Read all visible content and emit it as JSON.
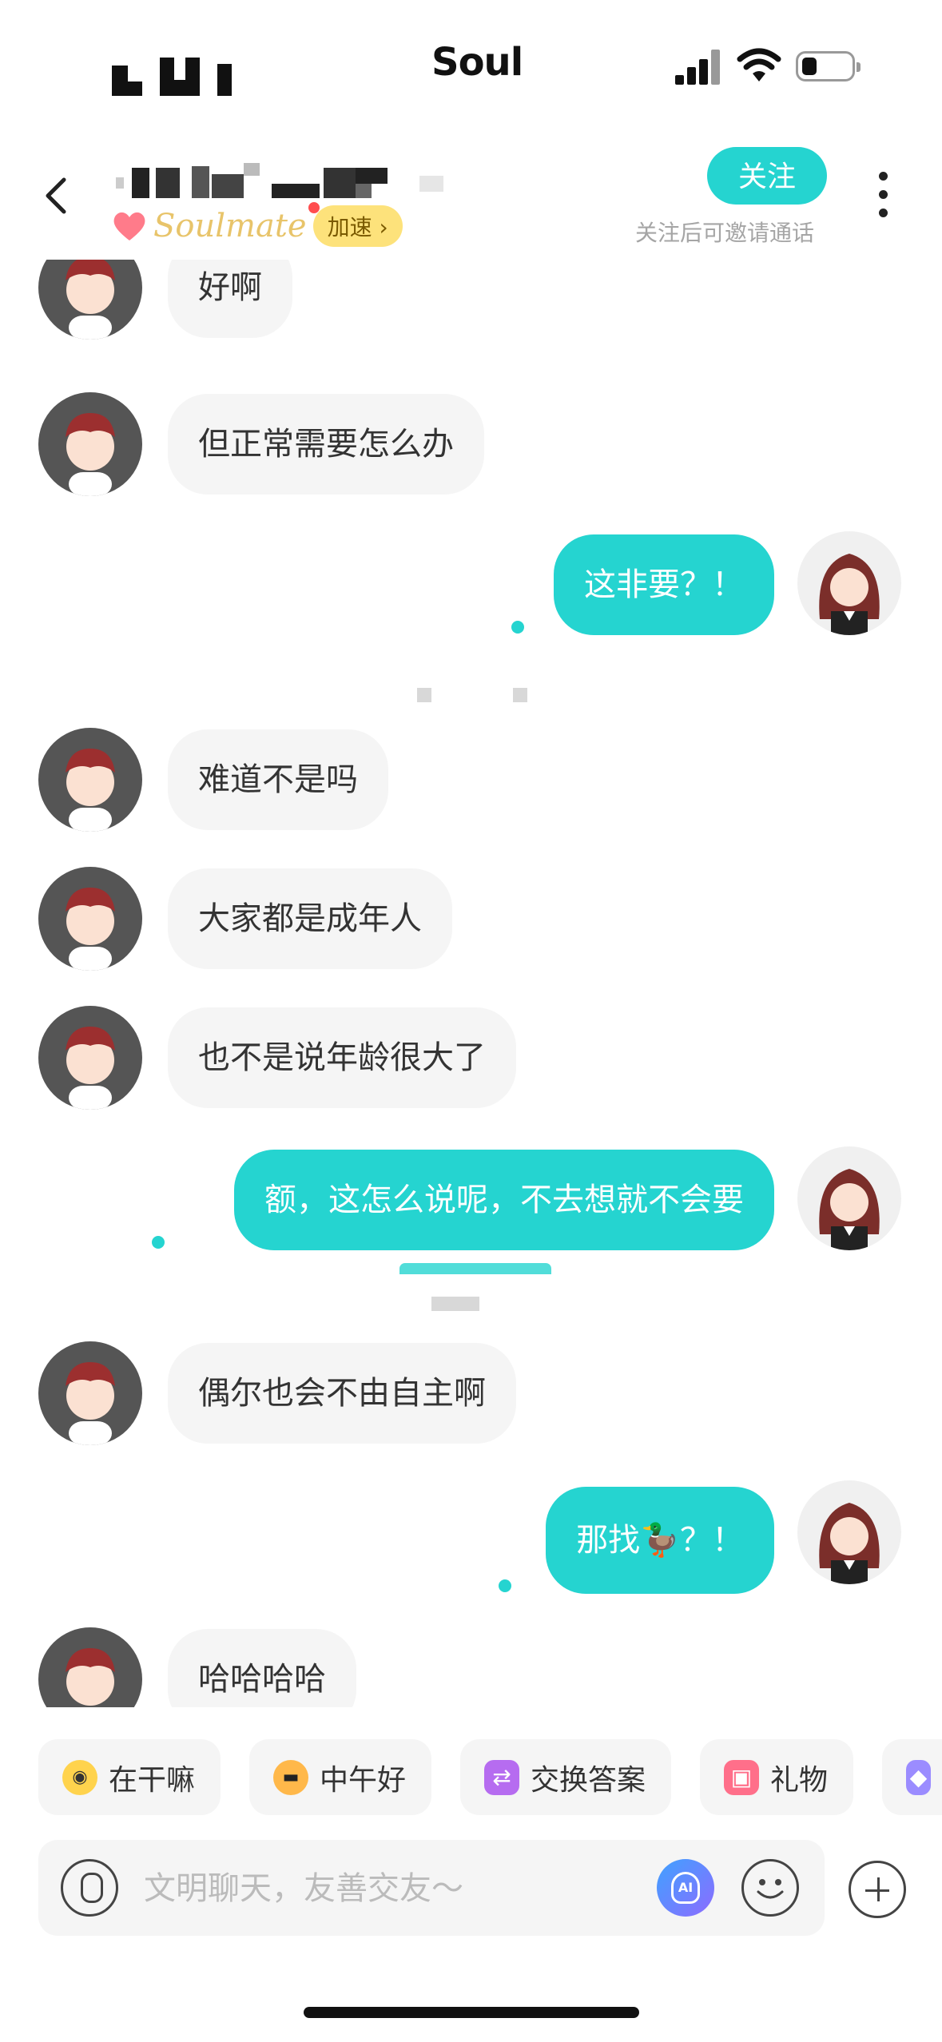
{
  "status_bar": {
    "carrier": "Soul"
  },
  "header": {
    "soulmate_label": "Soulmate",
    "speed_badge": "加速 ›",
    "follow_label": "关注",
    "follow_hint": "关注后可邀请通话"
  },
  "messages": [
    {
      "side": "them",
      "text": "好啊"
    },
    {
      "side": "them",
      "text": "但正常需要怎么办"
    },
    {
      "side": "me",
      "text": "这非要？！"
    },
    {
      "side": "them",
      "text": "难道不是吗"
    },
    {
      "side": "them",
      "text": "大家都是成年人"
    },
    {
      "side": "them",
      "text": "也不是说年龄很大了"
    },
    {
      "side": "me",
      "text": "额，这怎么说呢，不去想就不会要"
    },
    {
      "side": "them",
      "text": "偶尔也会不由自主啊"
    },
    {
      "side": "me",
      "text": "那找🦆？！"
    },
    {
      "side": "them",
      "text": "哈哈哈哈"
    }
  ],
  "quick_replies": [
    "在干嘛",
    "中午好",
    "交换答案",
    "礼物"
  ],
  "input": {
    "placeholder": "文明聊天，友善交友～"
  },
  "colors": {
    "accent": "#25d4d0",
    "bubble_them": "#f5f5f5"
  }
}
